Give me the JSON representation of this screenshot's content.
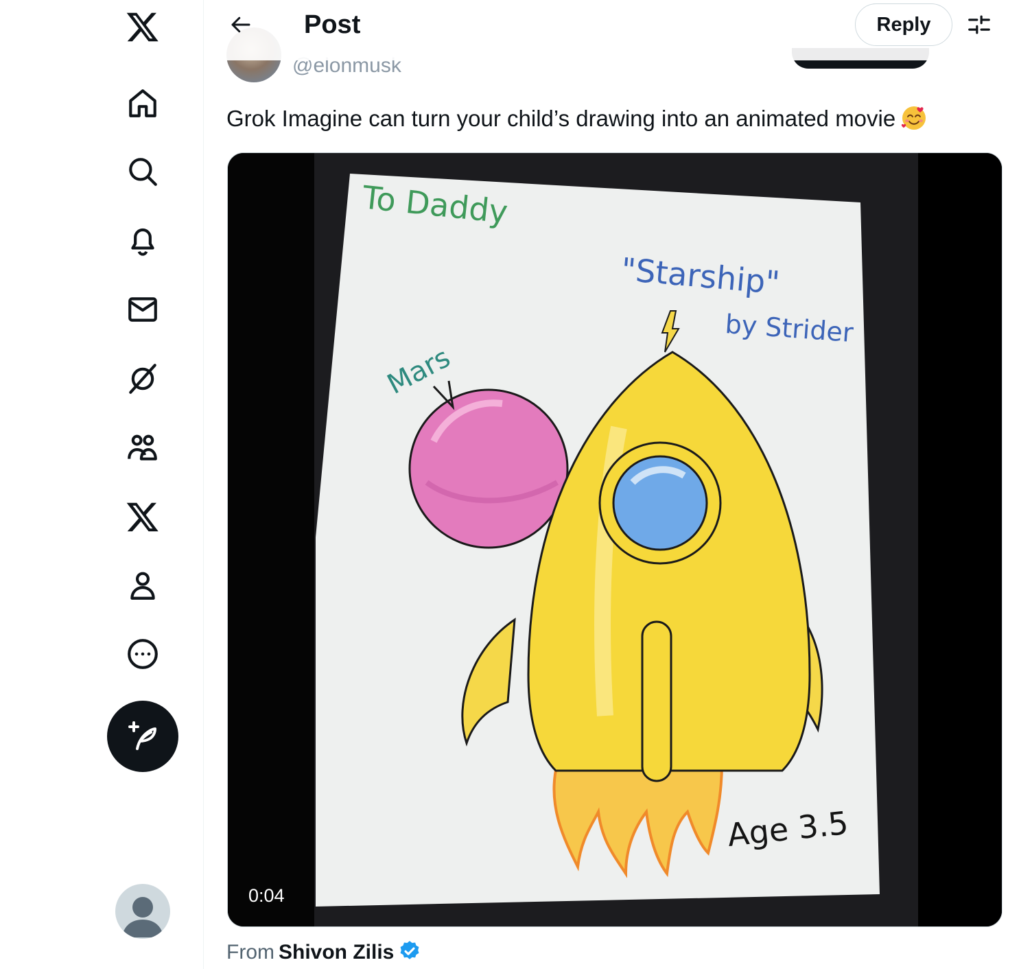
{
  "header": {
    "title": "Post",
    "reply_label": "Reply"
  },
  "post": {
    "author_handle": "@elonmusk",
    "text": "Grok Imagine can turn your child’s drawing into an animated movie",
    "emoji": "smiling-face-with-hearts",
    "video_duration": "0:04",
    "drawing_text": {
      "dedication": "To Daddy",
      "title": "\"Starship\"",
      "artist": "by Strider",
      "planet": "Mars",
      "age": "Age 3.5"
    },
    "source_prefix": "From",
    "source_name": "Shivon Zilis",
    "source_verified": true
  },
  "nav": {
    "items": [
      "x-logo",
      "home",
      "explore",
      "notifications",
      "messages",
      "grok",
      "communities",
      "premium",
      "profile",
      "more"
    ]
  },
  "colors": {
    "text": "#0f1419",
    "muted": "#536471",
    "verified": "#1d9bf0",
    "border": "#cfd9de"
  }
}
